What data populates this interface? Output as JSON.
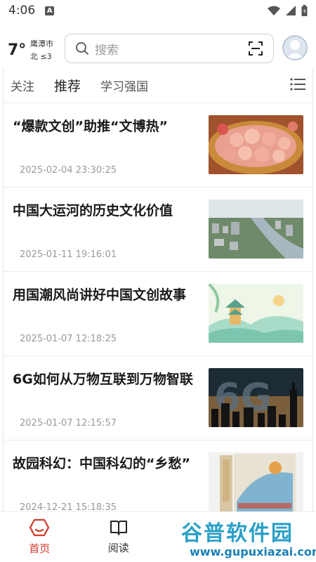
{
  "status_bar": {
    "time": "4:06",
    "badge": "A"
  },
  "weather": {
    "temp": "7°",
    "city": "鹰潭市",
    "wind": "北 ≤3"
  },
  "search": {
    "placeholder": "搜索"
  },
  "tabs": [
    {
      "label": "关注"
    },
    {
      "label": "推荐",
      "active": true
    },
    {
      "label": "学习强国"
    }
  ],
  "news": [
    {
      "title": "“爆款文创”助推“文博热”",
      "time": "2025-02-04 23:30:25",
      "thumb": "pink-toys"
    },
    {
      "title": "中国大运河的历史文化价值",
      "time": "2025-01-11 19:16:01",
      "thumb": "canal-city"
    },
    {
      "title": "用国潮风尚讲好中国文创故事",
      "time": "2025-01-07 12:18:25",
      "thumb": "pavilion-art"
    },
    {
      "title": "6G如何从万物互联到万物智联",
      "time": "2025-01-07 12:15:57",
      "thumb": "6g-skyline"
    },
    {
      "title": "故园科幻：中国科幻的“乡愁”",
      "time": "2024-12-21 15:18:35",
      "thumb": "book-covers"
    }
  ],
  "bottom_nav": [
    {
      "label": "首页",
      "icon": "home-hexagon-icon",
      "active": true
    },
    {
      "label": "阅读",
      "icon": "book-icon"
    }
  ],
  "watermark": {
    "text": "谷普软件园",
    "url": "www.gupuxiazai.com"
  },
  "colors": {
    "accent": "#d23a2a",
    "time_gray": "#999999",
    "watermark": "#2aa0c8"
  }
}
